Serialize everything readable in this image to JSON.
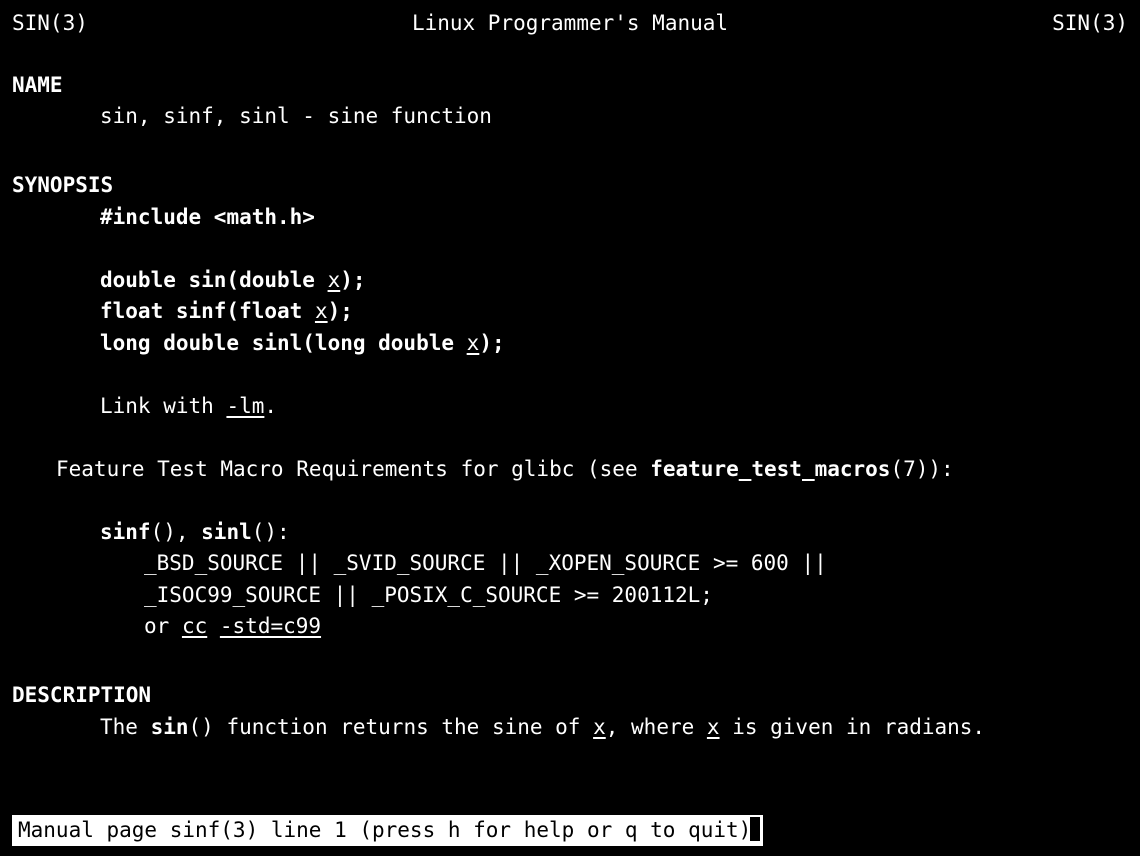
{
  "header": {
    "left": "SIN(3)",
    "center": "Linux Programmer's Manual",
    "right": "SIN(3)"
  },
  "sections": {
    "name": {
      "heading": "NAME",
      "text": "sin, sinf, sinl - sine function"
    },
    "synopsis": {
      "heading": "SYNOPSIS",
      "include_pre": "#include ",
      "include_hdr": "<math.h>",
      "proto1_a": "double sin(double ",
      "proto1_b": "x",
      "proto1_c": ");",
      "proto2_a": "float sinf(float ",
      "proto2_b": "x",
      "proto2_c": ");",
      "proto3_a": "long double sinl(long double ",
      "proto3_b": "x",
      "proto3_c": ");",
      "link_pre": "Link with ",
      "link_flag": "-lm",
      "link_post": ".",
      "ftm_intro_a": "Feature Test Macro Requirements for glibc (see ",
      "ftm_intro_b": "feature_test_macros",
      "ftm_intro_c": "(7)):",
      "ftm_funcs_a": "sinf",
      "ftm_funcs_b": "(), ",
      "ftm_funcs_c": "sinl",
      "ftm_funcs_d": "():",
      "ftm_line1": "_BSD_SOURCE || _SVID_SOURCE || _XOPEN_SOURCE >= 600 ||",
      "ftm_line2": "_ISOC99_SOURCE || _POSIX_C_SOURCE >= 200112L;",
      "ftm_line3_a": "or ",
      "ftm_line3_b": "cc",
      "ftm_line3_c": " ",
      "ftm_line3_d": "-std=c99"
    },
    "description": {
      "heading": "DESCRIPTION",
      "d1": "The ",
      "d2": "sin",
      "d3": "() function returns the sine of ",
      "d4": "x",
      "d5": ", where ",
      "d6": "x",
      "d7": " is given in radians."
    }
  },
  "status": "Manual page sinf(3) line 1 (press h for help or q to quit)"
}
